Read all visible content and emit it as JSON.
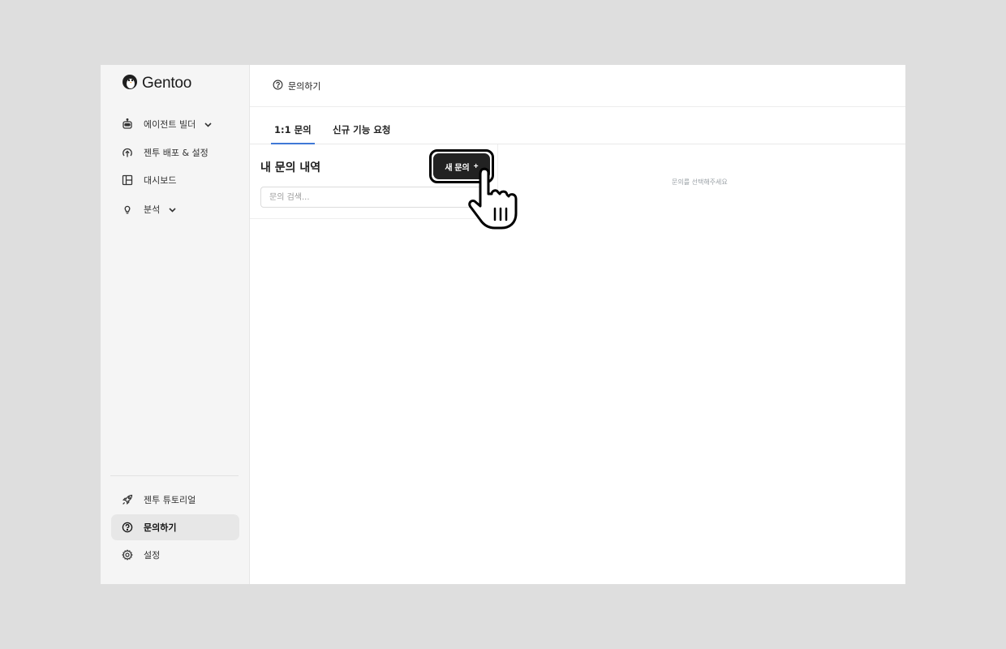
{
  "app": {
    "logo_text": "Gentoo"
  },
  "sidebar": {
    "items": [
      {
        "label": "에이전트 빌더",
        "icon": "robot-icon",
        "has_chevron": true
      },
      {
        "label": "젠투 배포 & 설정",
        "icon": "upload-icon"
      },
      {
        "label": "대시보드",
        "icon": "layout-icon"
      },
      {
        "label": "분석",
        "icon": "lightbulb-icon",
        "has_chevron": true
      }
    ],
    "bottom_items": [
      {
        "label": "젠투 튜토리얼",
        "icon": "rocket-icon"
      },
      {
        "label": "문의하기",
        "icon": "question-icon",
        "active": true
      },
      {
        "label": "설정",
        "icon": "gear-icon"
      }
    ]
  },
  "header": {
    "title": "문의하기",
    "icon": "question-icon"
  },
  "tabs": [
    {
      "label": "1:1 문의",
      "active": true
    },
    {
      "label": "신규 기능 요청",
      "active": false
    }
  ],
  "inquiry_list": {
    "title": "내 문의 내역",
    "new_button_label": "새 문의",
    "new_button_symbol": "+",
    "search_placeholder": "문의 검색..."
  },
  "detail": {
    "empty_message": "문의를 선택해주세요"
  },
  "colors": {
    "accent": "#3f78d6",
    "button_bg": "#222222",
    "sidebar_bg": "#f5f5f5"
  }
}
